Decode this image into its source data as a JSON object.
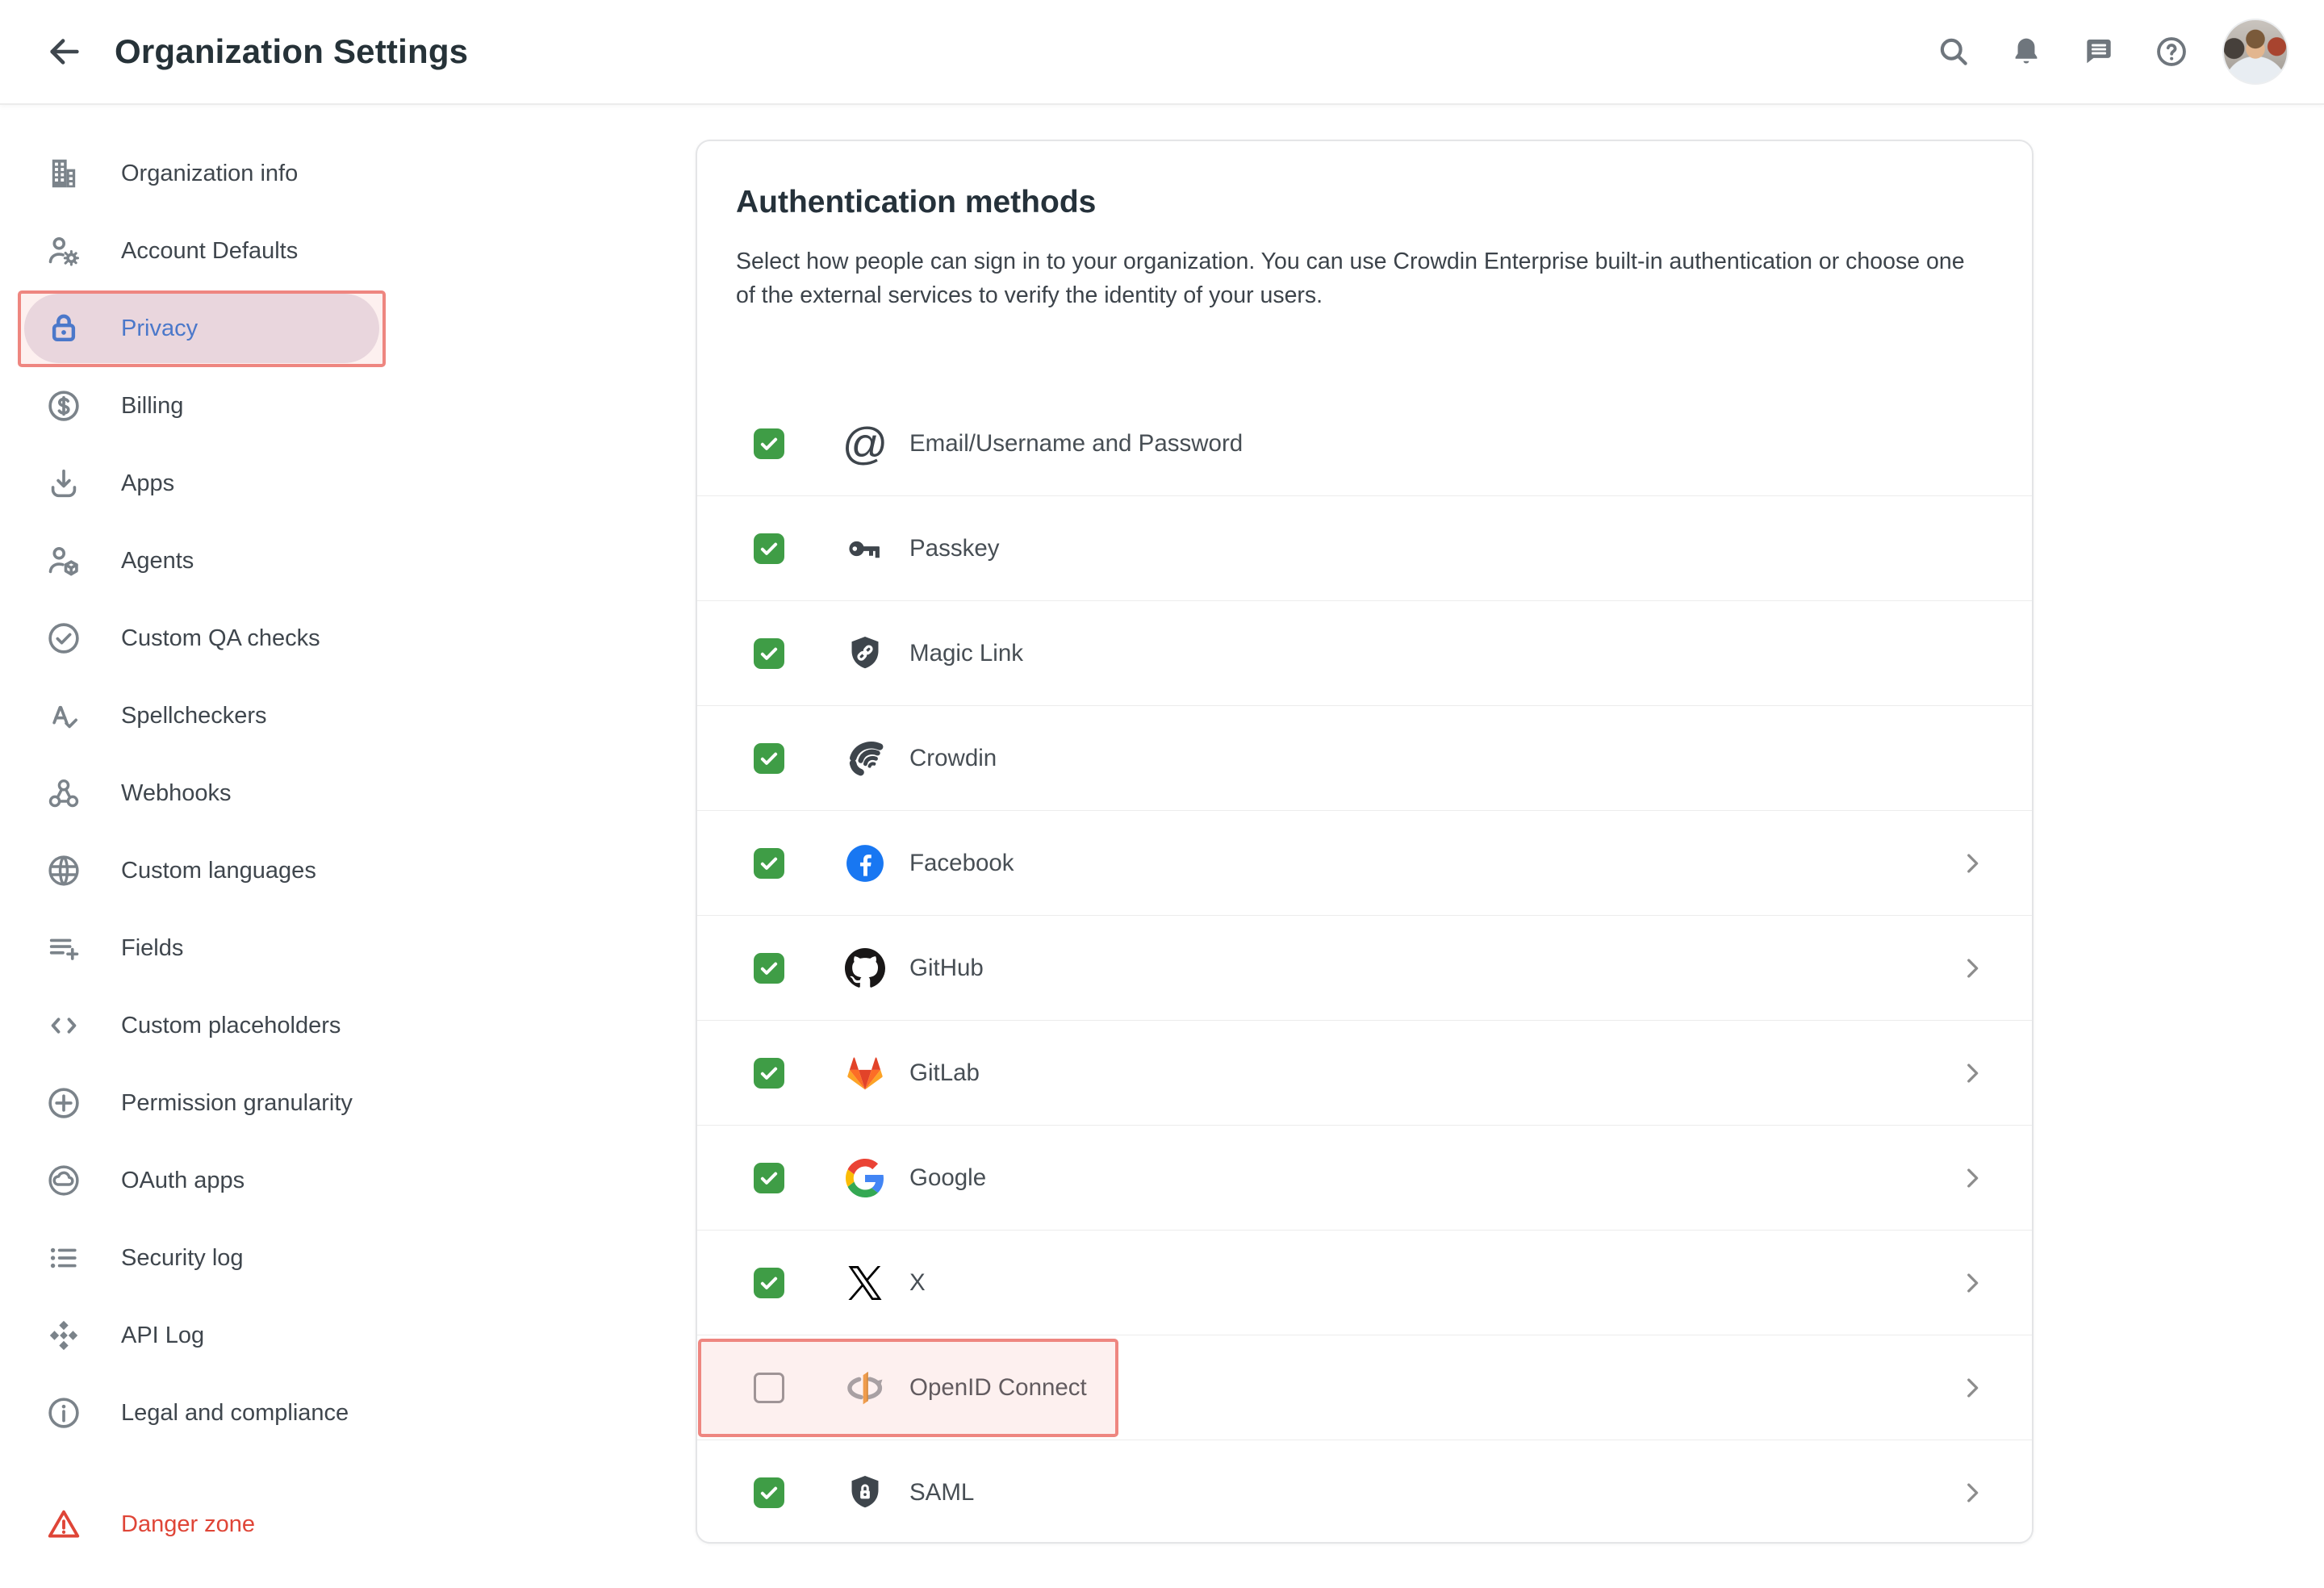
{
  "header": {
    "title": "Organization Settings",
    "back_icon": "arrow-back",
    "action_icons": [
      "search",
      "notifications",
      "messages",
      "help"
    ],
    "avatar_alt": "user avatar photo"
  },
  "sidebar": {
    "items": [
      {
        "label": "Organization info",
        "icon": "building"
      },
      {
        "label": "Account Defaults",
        "icon": "user-gear"
      },
      {
        "label": "Privacy",
        "icon": "lock",
        "active": true,
        "annotated": true
      },
      {
        "label": "Billing",
        "icon": "dollar-circle"
      },
      {
        "label": "Apps",
        "icon": "download"
      },
      {
        "label": "Agents",
        "icon": "user-cube"
      },
      {
        "label": "Custom QA checks",
        "icon": "check-circle"
      },
      {
        "label": "Spellcheckers",
        "icon": "spellcheck"
      },
      {
        "label": "Webhooks",
        "icon": "webhook"
      },
      {
        "label": "Custom languages",
        "icon": "globe"
      },
      {
        "label": "Fields",
        "icon": "list-plus"
      },
      {
        "label": "Custom placeholders",
        "icon": "code-brackets"
      },
      {
        "label": "Permission granularity",
        "icon": "plus-circle"
      },
      {
        "label": "OAuth apps",
        "icon": "cloud-circle"
      },
      {
        "label": "Security log",
        "icon": "bullet-list"
      },
      {
        "label": "API Log",
        "icon": "diamonds"
      },
      {
        "label": "Legal and compliance",
        "icon": "info-circle"
      },
      {
        "label": "Danger zone",
        "icon": "warning-triangle",
        "danger": true
      }
    ]
  },
  "card": {
    "title": "Authentication methods",
    "description": "Select how people can sign in to your organization. You can use Crowdin Enterprise built-in authentication or choose one of the external services to verify the identity of your users.",
    "rows": [
      {
        "label": "Email/Username and Password",
        "icon": "at",
        "checked": true,
        "chevron": false
      },
      {
        "label": "Passkey",
        "icon": "passkey",
        "checked": true,
        "chevron": false
      },
      {
        "label": "Magic Link",
        "icon": "magic-link",
        "checked": true,
        "chevron": false
      },
      {
        "label": "Crowdin",
        "icon": "crowdin",
        "checked": true,
        "chevron": false
      },
      {
        "label": "Facebook",
        "icon": "facebook",
        "checked": true,
        "chevron": true
      },
      {
        "label": "GitHub",
        "icon": "github",
        "checked": true,
        "chevron": true
      },
      {
        "label": "GitLab",
        "icon": "gitlab",
        "checked": true,
        "chevron": true
      },
      {
        "label": "Google",
        "icon": "google",
        "checked": true,
        "chevron": true
      },
      {
        "label": "X",
        "icon": "x-logo",
        "checked": true,
        "chevron": true
      },
      {
        "label": "OpenID Connect",
        "icon": "openid",
        "checked": false,
        "chevron": true,
        "annotated": true
      },
      {
        "label": "SAML",
        "icon": "saml",
        "checked": true,
        "chevron": true
      }
    ]
  },
  "colors": {
    "accent_green": "#3f9d46",
    "active_blue": "#2b71d3",
    "danger_red": "#df4537",
    "highlight_border": "#ee8680",
    "highlight_fill": "rgba(244,160,154,0.16)",
    "facebook_blue": "#1877f2",
    "openid_orange": "#ef9b3d"
  }
}
